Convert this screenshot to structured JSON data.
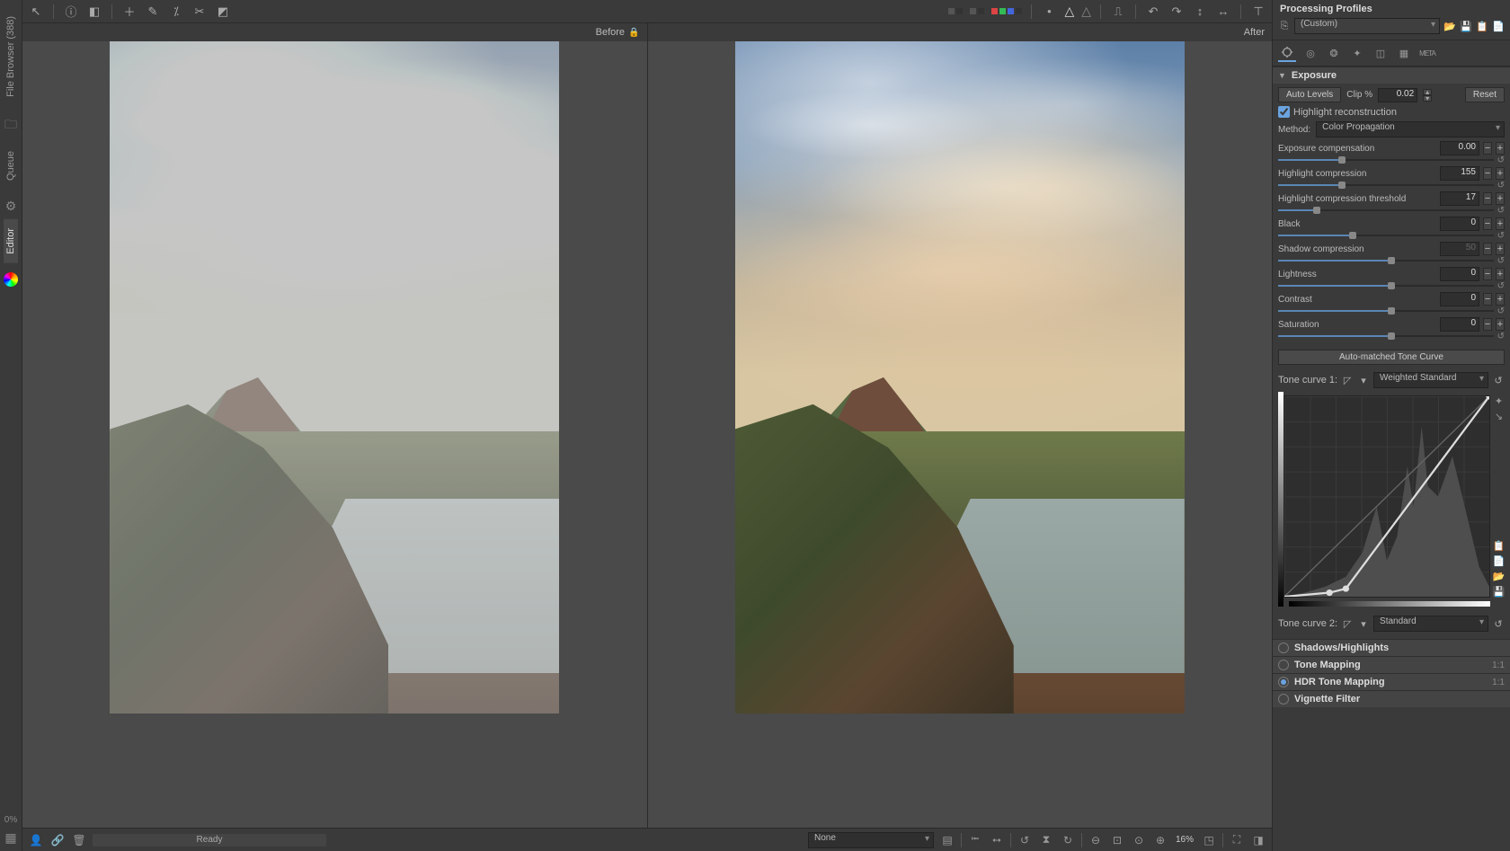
{
  "left_tabs": {
    "file_browser": "File Browser (388)",
    "queue": "Queue",
    "editor": "Editor",
    "progress_pct": "0%"
  },
  "ba": {
    "before": "Before",
    "after": "After"
  },
  "bottom": {
    "ready": "Ready",
    "detail_combo": "None",
    "zoom_pct": "16%"
  },
  "profiles": {
    "header": "Processing Profiles",
    "current": "(Custom)"
  },
  "exposure": {
    "title": "Exposure",
    "auto_levels": "Auto Levels",
    "clip_label": "Clip %",
    "clip_val": "0.02",
    "reset": "Reset",
    "hl_recon": "Highlight reconstruction",
    "hl_recon_checked": true,
    "method_label": "Method:",
    "method_value": "Color Propagation",
    "sliders": [
      {
        "id": "ev",
        "label": "Exposure compensation",
        "value": "0.00",
        "pos": 28,
        "disabled": false
      },
      {
        "id": "hc",
        "label": "Highlight compression",
        "value": "155",
        "pos": 28,
        "disabled": false
      },
      {
        "id": "hct",
        "label": "Highlight compression threshold",
        "value": "17",
        "pos": 17,
        "disabled": false
      },
      {
        "id": "blk",
        "label": "Black",
        "value": "0",
        "pos": 33,
        "disabled": false
      },
      {
        "id": "shc",
        "label": "Shadow compression",
        "value": "50",
        "pos": 50,
        "disabled": true
      },
      {
        "id": "lit",
        "label": "Lightness",
        "value": "0",
        "pos": 50,
        "disabled": false
      },
      {
        "id": "con",
        "label": "Contrast",
        "value": "0",
        "pos": 50,
        "disabled": false
      },
      {
        "id": "sat",
        "label": "Saturation",
        "value": "0",
        "pos": 50,
        "disabled": false
      }
    ],
    "auto_tone_curve": "Auto-matched Tone Curve",
    "tone_curve_1_label": "Tone curve 1:",
    "tone_curve_1_value": "Weighted Standard",
    "tone_curve_2_label": "Tone curve 2:",
    "tone_curve_2_value": "Standard"
  },
  "sections": {
    "shadows_highlights": "Shadows/Highlights",
    "tone_mapping": "Tone Mapping",
    "hdr_tone_mapping": "HDR Tone Mapping",
    "vignette_filter": "Vignette Filter"
  }
}
